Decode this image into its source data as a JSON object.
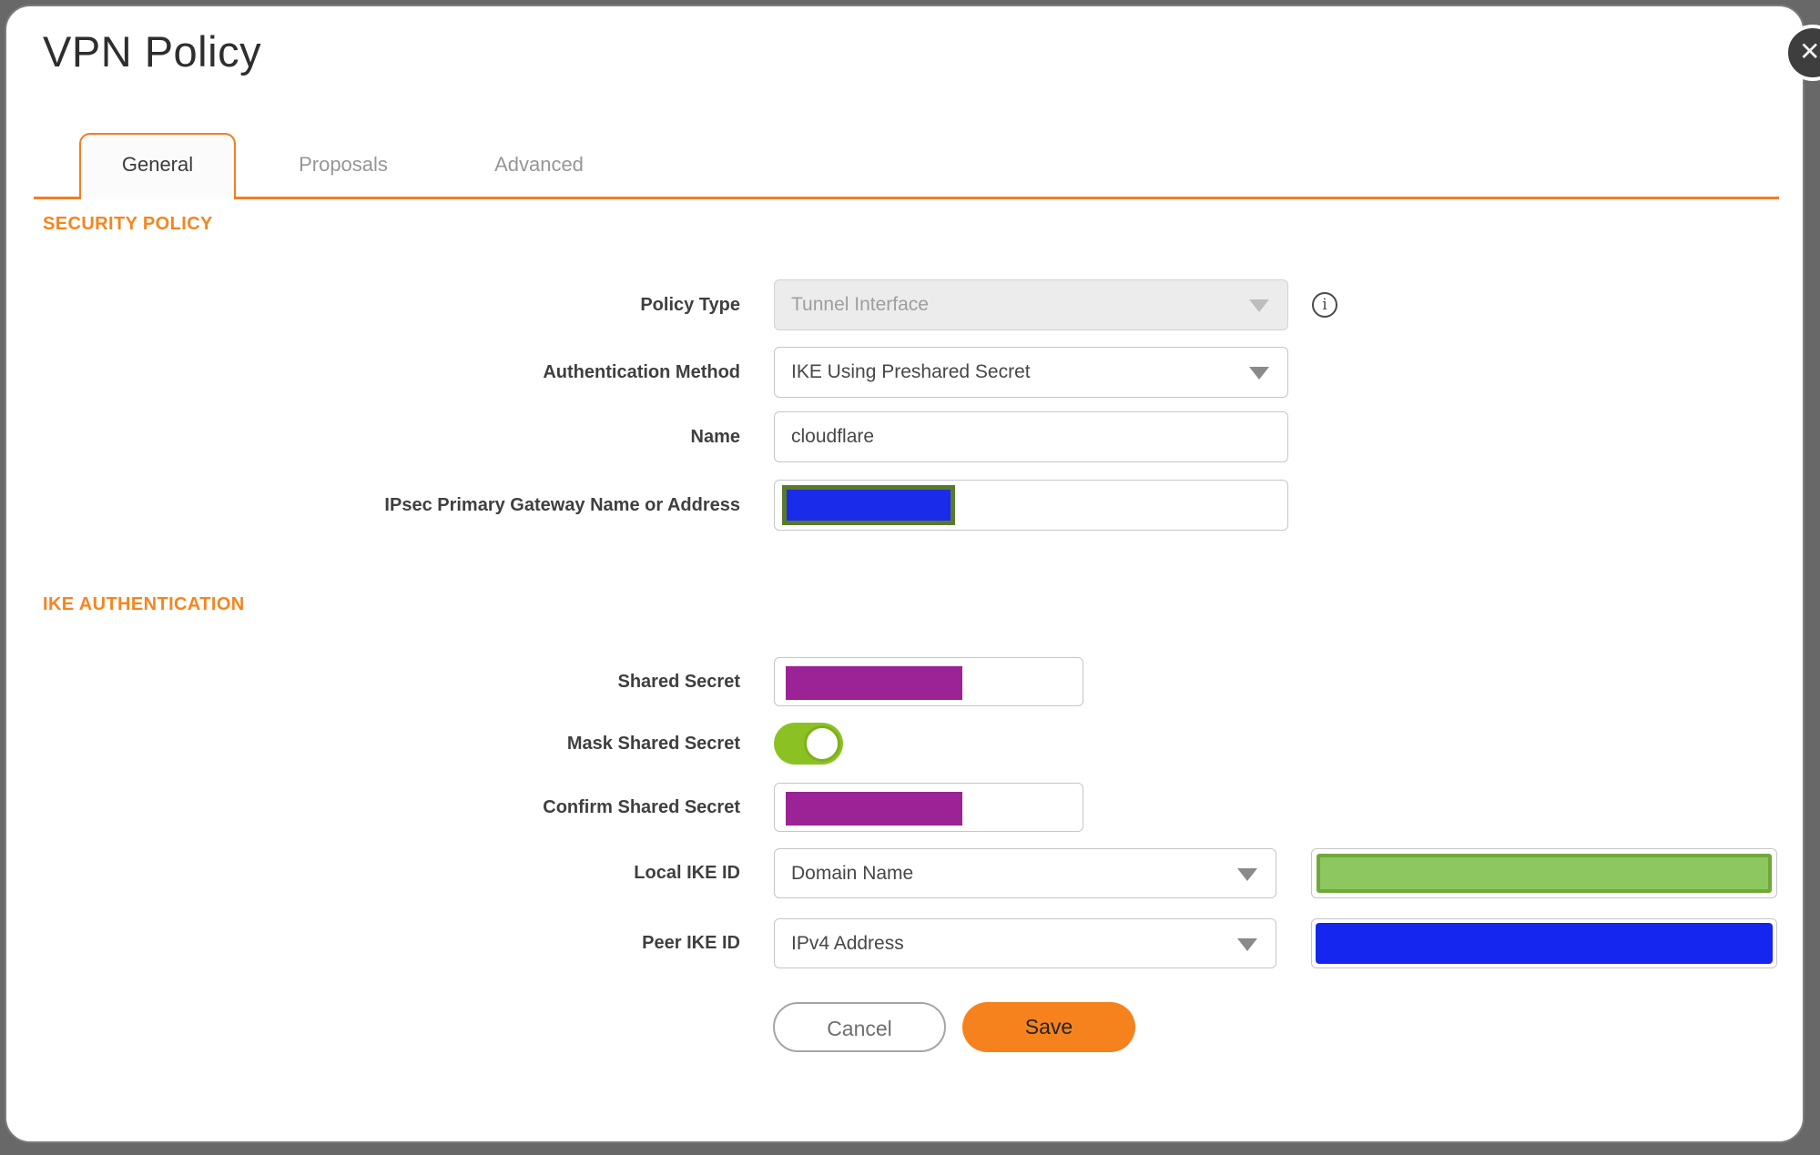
{
  "dialog": {
    "title": "VPN Policy",
    "close_icon": "✕",
    "info_icon": "i"
  },
  "tabs": [
    {
      "label": "General",
      "active": true
    },
    {
      "label": "Proposals",
      "active": false
    },
    {
      "label": "Advanced",
      "active": false
    }
  ],
  "sections": {
    "security_policy": "SECURITY POLICY",
    "ike_authentication": "IKE AUTHENTICATION"
  },
  "fields": {
    "policy_type": {
      "label": "Policy Type",
      "value": "Tunnel Interface",
      "disabled": true
    },
    "auth_method": {
      "label": "Authentication Method",
      "value": "IKE Using Preshared Secret"
    },
    "name": {
      "label": "Name",
      "value": "cloudflare"
    },
    "gateway": {
      "label": "IPsec Primary Gateway Name or Address",
      "value": "",
      "redaction": "blue-with-olive-border"
    },
    "shared_secret": {
      "label": "Shared Secret",
      "redaction": "purple"
    },
    "mask_shared_secret": {
      "label": "Mask Shared Secret",
      "toggle_on": true
    },
    "confirm_shared_secret": {
      "label": "Confirm Shared Secret",
      "redaction": "purple"
    },
    "local_ike_id": {
      "label": "Local IKE ID",
      "value": "Domain Name",
      "value_field_redaction": "green"
    },
    "peer_ike_id": {
      "label": "Peer IKE ID",
      "value": "IPv4 Address",
      "value_field_redaction": "blue"
    }
  },
  "buttons": {
    "cancel": "Cancel",
    "save": "Save"
  },
  "colors": {
    "accent_orange": "#F6821D",
    "redaction_purple": "#9B2396",
    "redaction_blue": "#1527EE",
    "redaction_green_fill": "#8DC75F",
    "redaction_green_border": "#71A83A",
    "redaction_olive_border": "#5A7A2B",
    "toggle_green": "#8CC124",
    "page_background_gray": "#686868"
  }
}
